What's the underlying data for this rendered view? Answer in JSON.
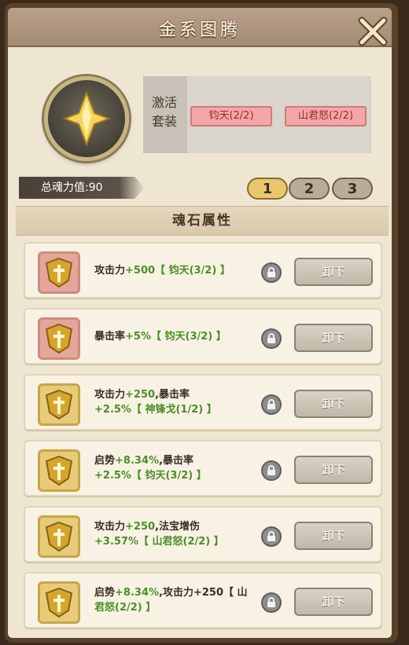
{
  "header": {
    "title": "金系图腾"
  },
  "soul_power": {
    "label": "总魂力值:90"
  },
  "suit": {
    "label_line1": "激活",
    "label_line2": "套装",
    "tags": [
      "钧天(2/2)",
      "山君怒(2/2)"
    ]
  },
  "tabs": [
    {
      "label": "1",
      "active": true
    },
    {
      "label": "2",
      "active": false
    },
    {
      "label": "3",
      "active": false
    }
  ],
  "section": {
    "title": "魂石属性"
  },
  "button_label": "卸下",
  "rows": [
    {
      "line1_a": "攻击力",
      "line1_b": "+500",
      "line1_c": "【 钧天(3/2) 】",
      "line2_a": "",
      "line2_b": ""
    },
    {
      "line1_a": "暴击率",
      "line1_b": "+5%",
      "line1_c": "【 钧天(3/2) 】",
      "line2_a": "",
      "line2_b": ""
    },
    {
      "line1_a": "攻击力",
      "line1_b": "+250",
      "line1_c": ",暴击率",
      "line2_a": "+2.5%",
      "line2_b": "【 神锋戈(1/2) 】"
    },
    {
      "line1_a": "启势",
      "line1_b": "+8.34%",
      "line1_c": ",暴击率",
      "line2_a": "+2.5%",
      "line2_b": "【 钧天(3/2) 】"
    },
    {
      "line1_a": "攻击力",
      "line1_b": "+250",
      "line1_c": ",法宝增伤",
      "line2_a": "+3.57%",
      "line2_b": "【 山君怒(2/2) 】"
    },
    {
      "line1_a": "启势",
      "line1_b": "+8.34%",
      "line1_c": ",攻击力+250【 山",
      "line2_a": "",
      "line2_b": "君怒(2/2) 】"
    }
  ]
}
